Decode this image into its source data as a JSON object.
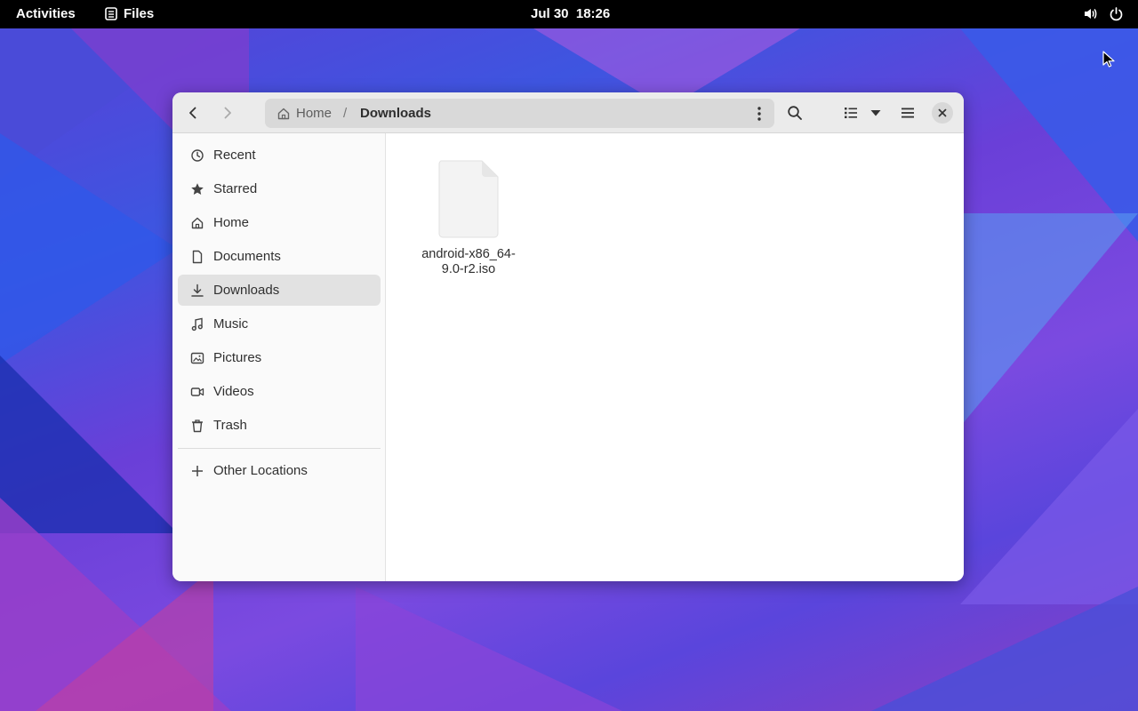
{
  "topbar": {
    "activities": "Activities",
    "app_name": "Files",
    "date": "Jul 30",
    "time": "18:26",
    "tray_icons": [
      "volume-icon",
      "power-icon"
    ]
  },
  "window": {
    "nav": {
      "back": "go-back",
      "forward": "go-forward"
    },
    "breadcrumb": {
      "home": "Home",
      "separator": "/",
      "current": "Downloads"
    },
    "toolbar_icons": [
      "search-icon",
      "list-view-icon",
      "view-options-chevron-icon",
      "hamburger-menu-icon",
      "close-icon"
    ]
  },
  "sidebar": {
    "items": [
      {
        "label": "Recent",
        "icon": "clock-icon"
      },
      {
        "label": "Starred",
        "icon": "star-icon"
      },
      {
        "label": "Home",
        "icon": "home-icon"
      },
      {
        "label": "Documents",
        "icon": "document-icon"
      },
      {
        "label": "Downloads",
        "icon": "download-icon",
        "active": true
      },
      {
        "label": "Music",
        "icon": "music-icon"
      },
      {
        "label": "Pictures",
        "icon": "picture-icon"
      },
      {
        "label": "Videos",
        "icon": "video-icon"
      },
      {
        "label": "Trash",
        "icon": "trash-icon"
      }
    ],
    "other_locations": {
      "label": "Other Locations",
      "icon": "plus-icon"
    }
  },
  "files": [
    {
      "name": "android-x86_64-9.0-r2.iso",
      "icon": "generic-file-icon"
    }
  ],
  "colors": {
    "topbar": "#000000",
    "headerbar": "#ebebeb",
    "sidebar": "#fafafa",
    "active_item": "#e2e2e2"
  }
}
